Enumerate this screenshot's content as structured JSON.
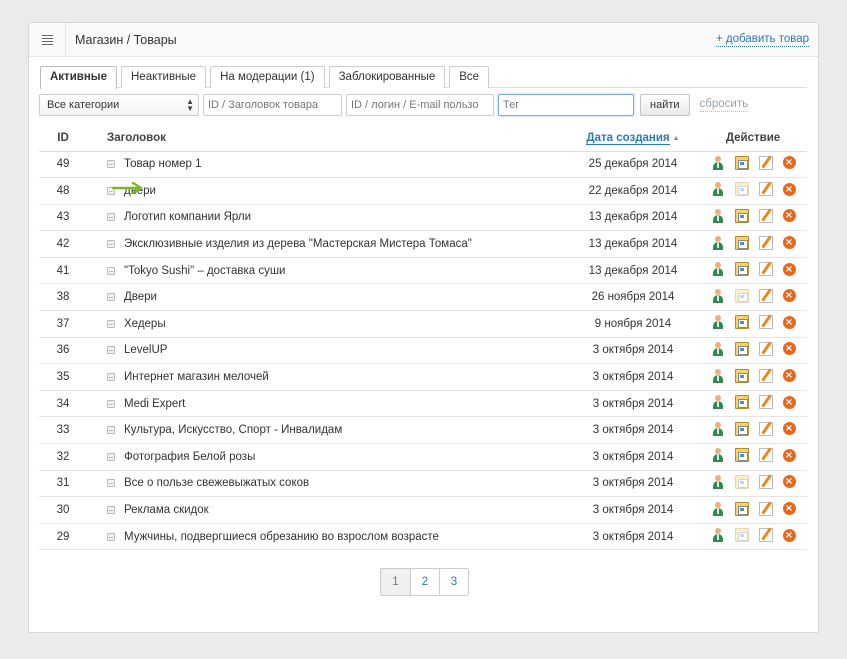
{
  "header": {
    "title": "Магазин / Товары",
    "add_label": "+ добавить товар"
  },
  "tabs": [
    {
      "label": "Активные",
      "active": true
    },
    {
      "label": "Неактивные",
      "active": false
    },
    {
      "label": "На модерации (1)",
      "active": false
    },
    {
      "label": "Заблокированные",
      "active": false
    },
    {
      "label": "Все",
      "active": false
    }
  ],
  "filters": {
    "category_value": "Все категории",
    "id_title_placeholder": "ID / Заголовок товара",
    "id_login_placeholder": "ID / логин / E-mail пользо",
    "tag_placeholder": "Тег",
    "find_label": "найти",
    "reset_label": "сбросить"
  },
  "table": {
    "headers": {
      "id": "ID",
      "title": "Заголовок",
      "date": "Дата создания",
      "action": "Действие"
    },
    "rows": [
      {
        "id": "49",
        "title": "Товар номер 1",
        "date": "25 декабря 2014",
        "photo_active": true
      },
      {
        "id": "48",
        "title": "двери",
        "date": "22 декабря 2014",
        "photo_active": false
      },
      {
        "id": "43",
        "title": "Логотип компании Ярли",
        "date": "13 декабря 2014",
        "photo_active": true
      },
      {
        "id": "42",
        "title": "Эксклюзивные изделия из дерева \"Мастерская Мистера Томаса\"",
        "date": "13 декабря 2014",
        "photo_active": true
      },
      {
        "id": "41",
        "title": "\"Tokyo Sushi\" – доставка суши",
        "date": "13 декабря 2014",
        "photo_active": true
      },
      {
        "id": "38",
        "title": "Двери",
        "date": "26 ноября 2014",
        "photo_active": false
      },
      {
        "id": "37",
        "title": "Хедеры",
        "date": "9 ноября 2014",
        "photo_active": true
      },
      {
        "id": "36",
        "title": "LevelUP",
        "date": "3 октября 2014",
        "photo_active": true
      },
      {
        "id": "35",
        "title": "Интернет магазин мелочей",
        "date": "3 октября 2014",
        "photo_active": true
      },
      {
        "id": "34",
        "title": "Medi Expert",
        "date": "3 октября 2014",
        "photo_active": true
      },
      {
        "id": "33",
        "title": "Культура, Искусство, Спорт - Инвалидам",
        "date": "3 октября 2014",
        "photo_active": true
      },
      {
        "id": "32",
        "title": "Фотография Белой розы",
        "date": "3 октября 2014",
        "photo_active": true
      },
      {
        "id": "31",
        "title": "Все о пользе свежевыжатых соков",
        "date": "3 октября 2014",
        "photo_active": false
      },
      {
        "id": "30",
        "title": "Реклама скидок",
        "date": "3 октября 2014",
        "photo_active": true
      },
      {
        "id": "29",
        "title": "Мужчины, подвергшиеся обрезанию во взрослом возрасте",
        "date": "3 октября 2014",
        "photo_active": false
      }
    ]
  },
  "pagination": {
    "pages": [
      "1",
      "2",
      "3"
    ],
    "current": "1"
  },
  "colors": {
    "link": "#2a7ab0",
    "delete": "#e8671d",
    "arrow": "#7ab52e"
  }
}
